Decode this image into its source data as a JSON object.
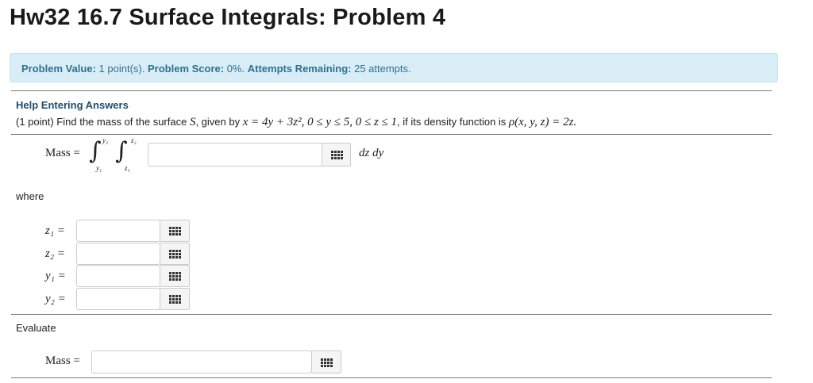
{
  "page": {
    "title": "Hw32 16.7 Surface Integrals: Problem 4"
  },
  "status": {
    "value_label": "Problem Value:",
    "value_text": "1 point(s).",
    "score_label": "Problem Score:",
    "score_text": "0%.",
    "attempts_label": "Attempts Remaining:",
    "attempts_text": "25 attempts."
  },
  "help_link": "Help Entering Answers",
  "problem": {
    "prefix": "(1 point) Find the mass of the surface ",
    "surface": "S",
    "given": ", given by ",
    "eq": "x = 4y + 3z²,  0 ≤ y ≤ 5,  0 ≤ z ≤ 1",
    "density_text": ", if its density function is ",
    "density": "ρ(x, y, z) = 2z."
  },
  "mass_integral": {
    "label": "Mass =",
    "upper_outer": "y₂",
    "lower_outer": "y₁",
    "upper_inner": "z₂",
    "lower_inner": "z₁",
    "differential": "dz dy"
  },
  "where_label": "where",
  "bounds": [
    {
      "label": "z₁ ="
    },
    {
      "label": "z₂ ="
    },
    {
      "label": "y₁ ="
    },
    {
      "label": "y₂ ="
    }
  ],
  "evaluate_label": "Evaluate",
  "final_mass_label": "Mass ="
}
